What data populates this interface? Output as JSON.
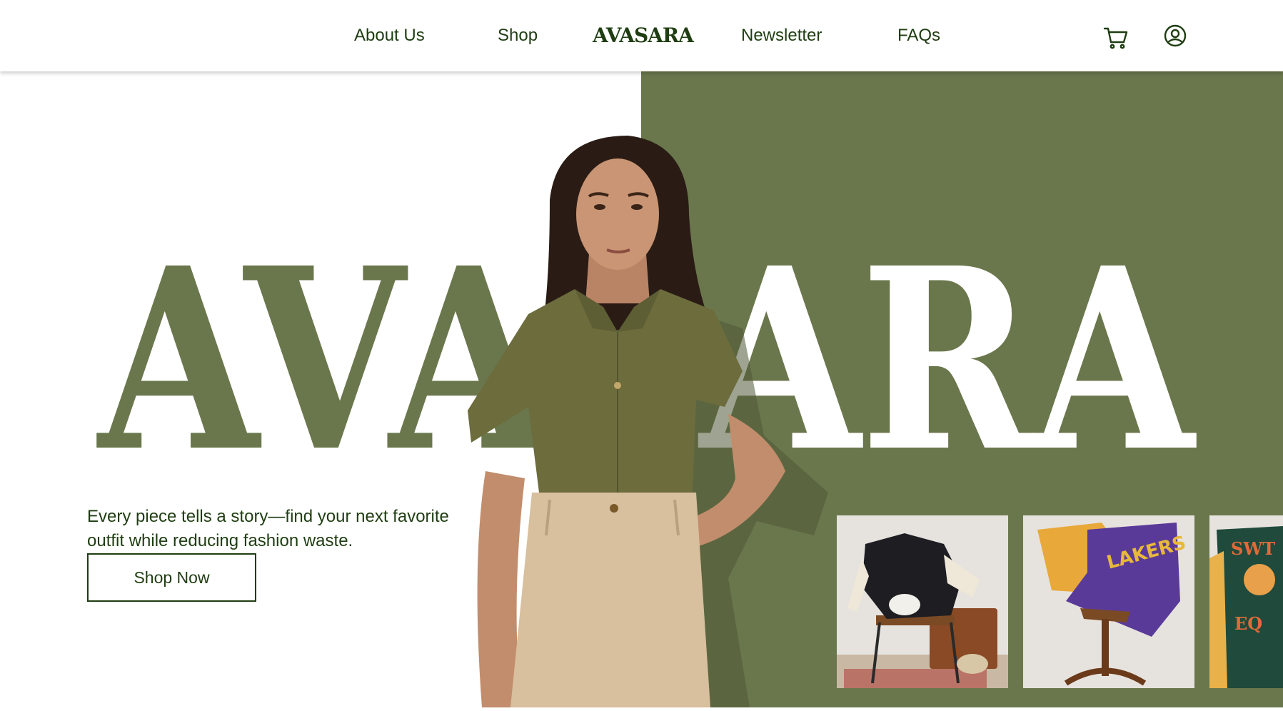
{
  "header": {
    "nav": [
      {
        "label": "About Us"
      },
      {
        "label": "Shop"
      },
      {
        "label": "Newsletter"
      },
      {
        "label": "FAQs"
      }
    ],
    "logo": "AVASARA",
    "icons": [
      "cart-icon",
      "user-account-icon"
    ]
  },
  "hero": {
    "headline": "AVASARA",
    "tagline": "Every piece tells a story—find your next favorite outfit while reducing fashion waste.",
    "cta_label": "Shop Now"
  },
  "products": [
    {
      "name": "varsity-jacket-on-chair"
    },
    {
      "name": "lakers-hoodie-on-stool"
    },
    {
      "name": "green-varsity-jacket"
    }
  ],
  "colors": {
    "brand_green": "#6a774c",
    "text_dark_green": "#1f3d12",
    "background": "#ffffff"
  }
}
